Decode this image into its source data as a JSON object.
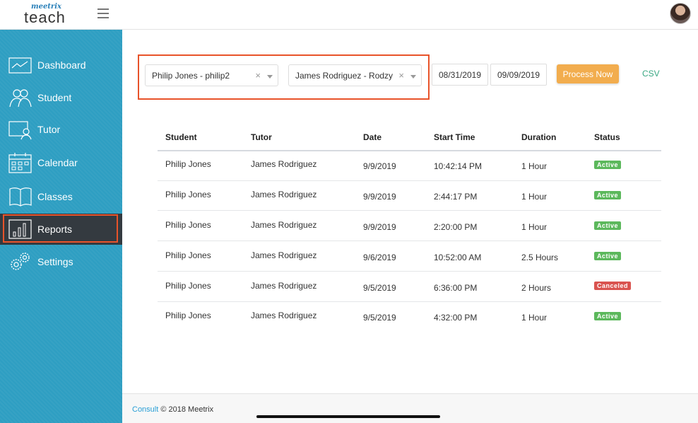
{
  "header": {
    "logo_small": "meetrix",
    "logo_big": "teach"
  },
  "sidebar": {
    "items": [
      {
        "label": "Dashboard",
        "icon": "dashboard-icon"
      },
      {
        "label": "Student",
        "icon": "student-icon"
      },
      {
        "label": "Tutor",
        "icon": "tutor-icon"
      },
      {
        "label": "Calendar",
        "icon": "calendar-icon"
      },
      {
        "label": "Classes",
        "icon": "classes-icon"
      },
      {
        "label": "Reports",
        "icon": "reports-icon",
        "active": true
      },
      {
        "label": "Settings",
        "icon": "settings-icon"
      }
    ]
  },
  "filters": {
    "student": "Philip Jones - philip2",
    "tutor": "James Rodriguez - Rodzy",
    "date_from": "08/31/2019",
    "date_to": "09/09/2019",
    "process_label": "Process Now",
    "csv_label": "CSV"
  },
  "table": {
    "headers": [
      "Student",
      "Tutor",
      "Date",
      "Start Time",
      "Duration",
      "Status"
    ],
    "rows": [
      {
        "student": "Philip Jones",
        "tutor": "James Rodriguez",
        "date": "9/9/2019",
        "start": "10:42:14 PM",
        "duration": "1 Hour",
        "status": "Active"
      },
      {
        "student": "Philip Jones",
        "tutor": "James Rodriguez",
        "date": "9/9/2019",
        "start": "2:44:17 PM",
        "duration": "1 Hour",
        "status": "Active"
      },
      {
        "student": "Philip Jones",
        "tutor": "James Rodriguez",
        "date": "9/9/2019",
        "start": "2:20:00 PM",
        "duration": "1 Hour",
        "status": "Active"
      },
      {
        "student": "Philip Jones",
        "tutor": "James Rodriguez",
        "date": "9/6/2019",
        "start": "10:52:00 AM",
        "duration": "2.5 Hours",
        "status": "Active"
      },
      {
        "student": "Philip Jones",
        "tutor": "James Rodriguez",
        "date": "9/5/2019",
        "start": "6:36:00 PM",
        "duration": "2 Hours",
        "status": "Canceled"
      },
      {
        "student": "Philip Jones",
        "tutor": "James Rodriguez",
        "date": "9/5/2019",
        "start": "4:32:00 PM",
        "duration": "1 Hour",
        "status": "Active"
      }
    ]
  },
  "footer": {
    "link": "Consult",
    "text": " © 2018 Meetrix"
  },
  "colors": {
    "sidebar": "#2e9ec2",
    "accent": "#f2ad4e",
    "highlight": "#e8532a",
    "active_badge": "#5cb85c",
    "canceled_badge": "#d9534f"
  }
}
